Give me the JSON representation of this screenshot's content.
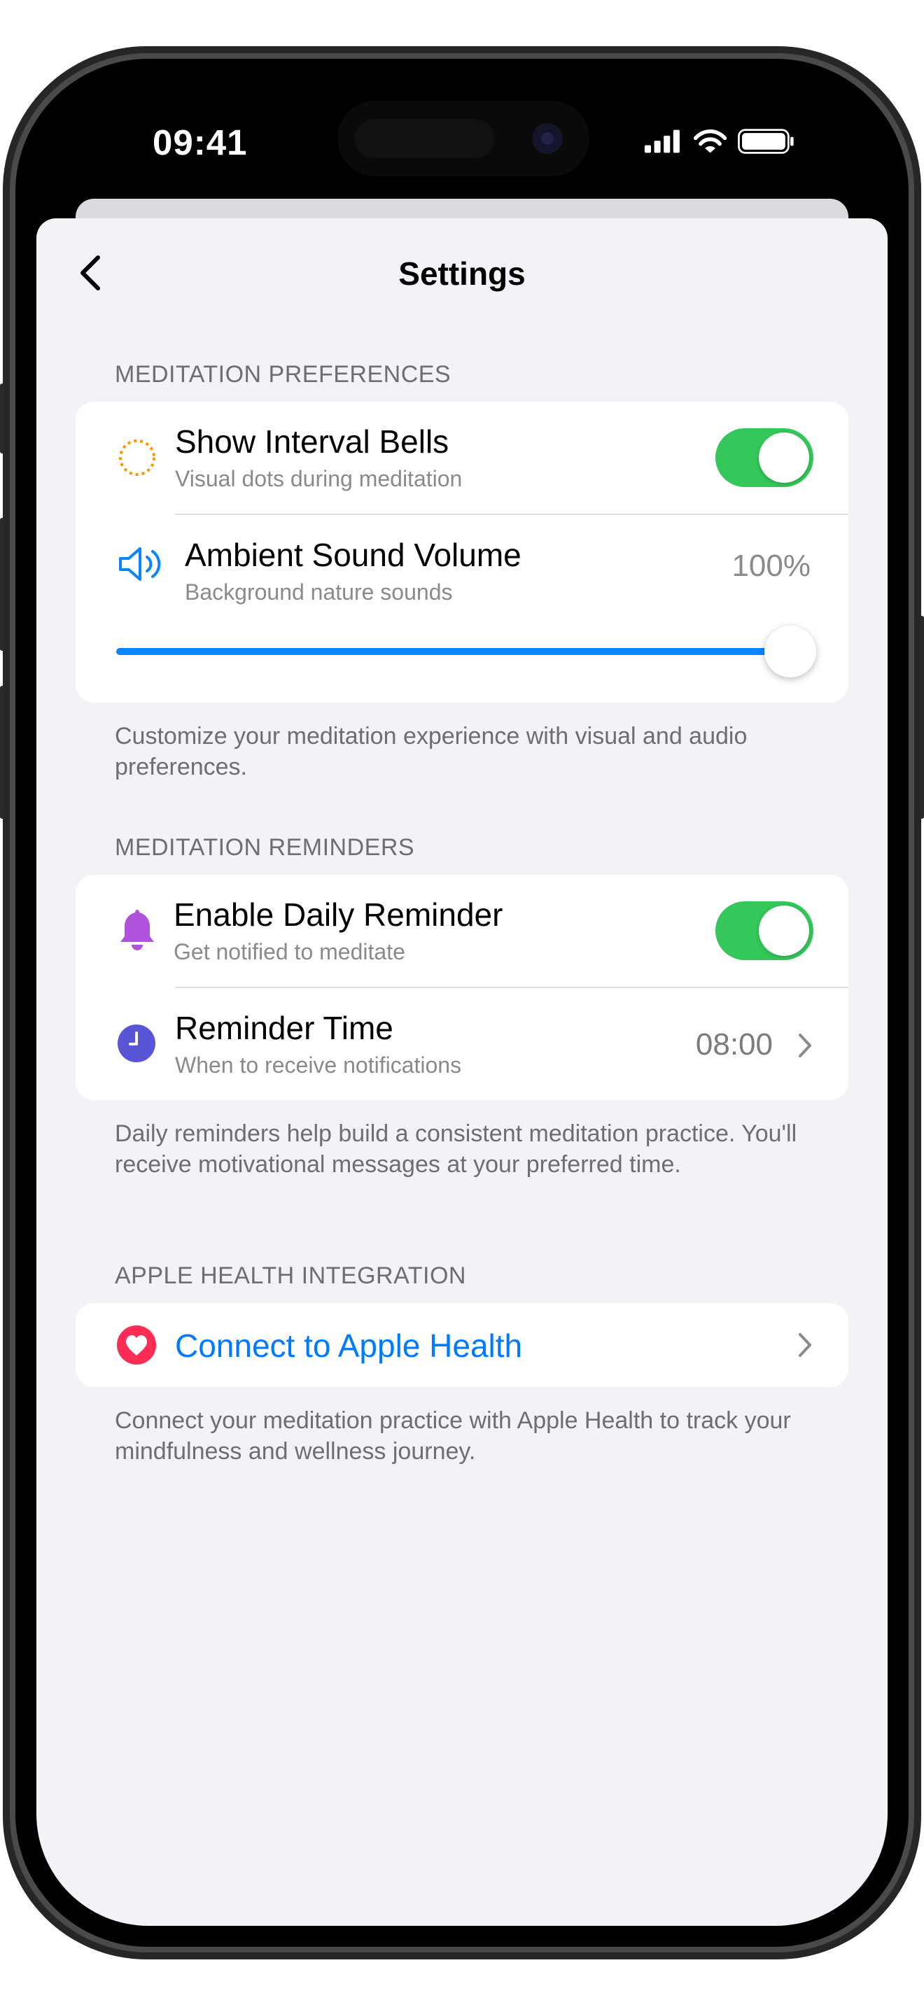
{
  "status_bar": {
    "time": "09:41"
  },
  "nav": {
    "title": "Settings"
  },
  "sections": {
    "preferences": {
      "header": "MEDITATION PREFERENCES",
      "bells_title": "Show Interval Bells",
      "bells_subtitle": "Visual dots during meditation",
      "bells_on": true,
      "volume_title": "Ambient Sound Volume",
      "volume_subtitle": "Background nature sounds",
      "volume_value": "100%",
      "volume_level": 1.0,
      "footer": "Customize your meditation experience with visual and audio preferences."
    },
    "reminders": {
      "header": "MEDITATION REMINDERS",
      "daily_title": "Enable Daily Reminder",
      "daily_subtitle": "Get notified to meditate",
      "daily_on": true,
      "time_title": "Reminder Time",
      "time_subtitle": "When to receive notifications",
      "time_value": "08:00",
      "footer": "Daily reminders help build a consistent meditation practice. You'll receive motivational messages at your preferred time."
    },
    "health": {
      "header": "APPLE HEALTH INTEGRATION",
      "connect_label": "Connect to Apple Health",
      "footer": "Connect your meditation practice with Apple Health to track your mindfulness and wellness journey."
    }
  },
  "icons": {
    "bells": "dotted-circle-icon",
    "volume": "speaker-wave-icon",
    "reminder": "bell-icon",
    "time": "clock-icon",
    "health": "heart-icon"
  },
  "colors": {
    "toggle_on": "#34c759",
    "accent_blue": "#0a84ff",
    "link_blue": "#007aff",
    "bells_orange": "#ff9500",
    "bell_purple": "#af52de",
    "clock_indigo": "#5856d6",
    "health_pink": "#ff2d55",
    "background": "#f2f2f7"
  }
}
